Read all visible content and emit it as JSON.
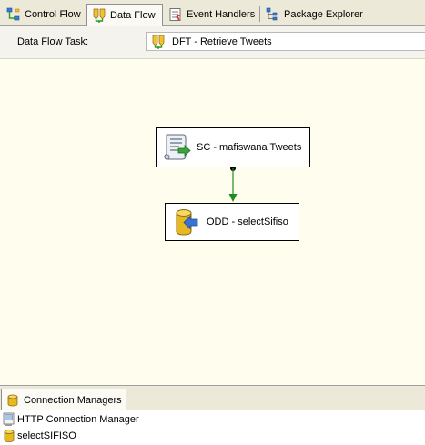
{
  "tabs": [
    {
      "label": "Control Flow",
      "icon": "control-flow-icon"
    },
    {
      "label": "Data Flow",
      "icon": "data-flow-icon",
      "active": true
    },
    {
      "label": "Event Handlers",
      "icon": "event-handlers-icon"
    },
    {
      "label": "Package Explorer",
      "icon": "package-explorer-icon"
    }
  ],
  "task_bar": {
    "label": "Data Flow Task:",
    "selected": "DFT - Retrieve Tweets"
  },
  "designer": {
    "source_component": {
      "label": "SC - mafiswana Tweets",
      "icon": "script-component-icon"
    },
    "destination_component": {
      "label": "ODD - selectSifiso",
      "icon": "database-destination-icon"
    },
    "connector_color": "#1f8c1f"
  },
  "connection_managers": {
    "tab_label": "Connection Managers",
    "items": [
      {
        "label": "HTTP Connection Manager",
        "icon": "http-connection-icon"
      },
      {
        "label": "selectSIFISO",
        "icon": "database-connection-icon"
      }
    ]
  },
  "colors": {
    "tab_strip_bg": "#ece9d8",
    "designer_bg": "#fffeee",
    "active_tab_bg": "#fbfaf5"
  }
}
